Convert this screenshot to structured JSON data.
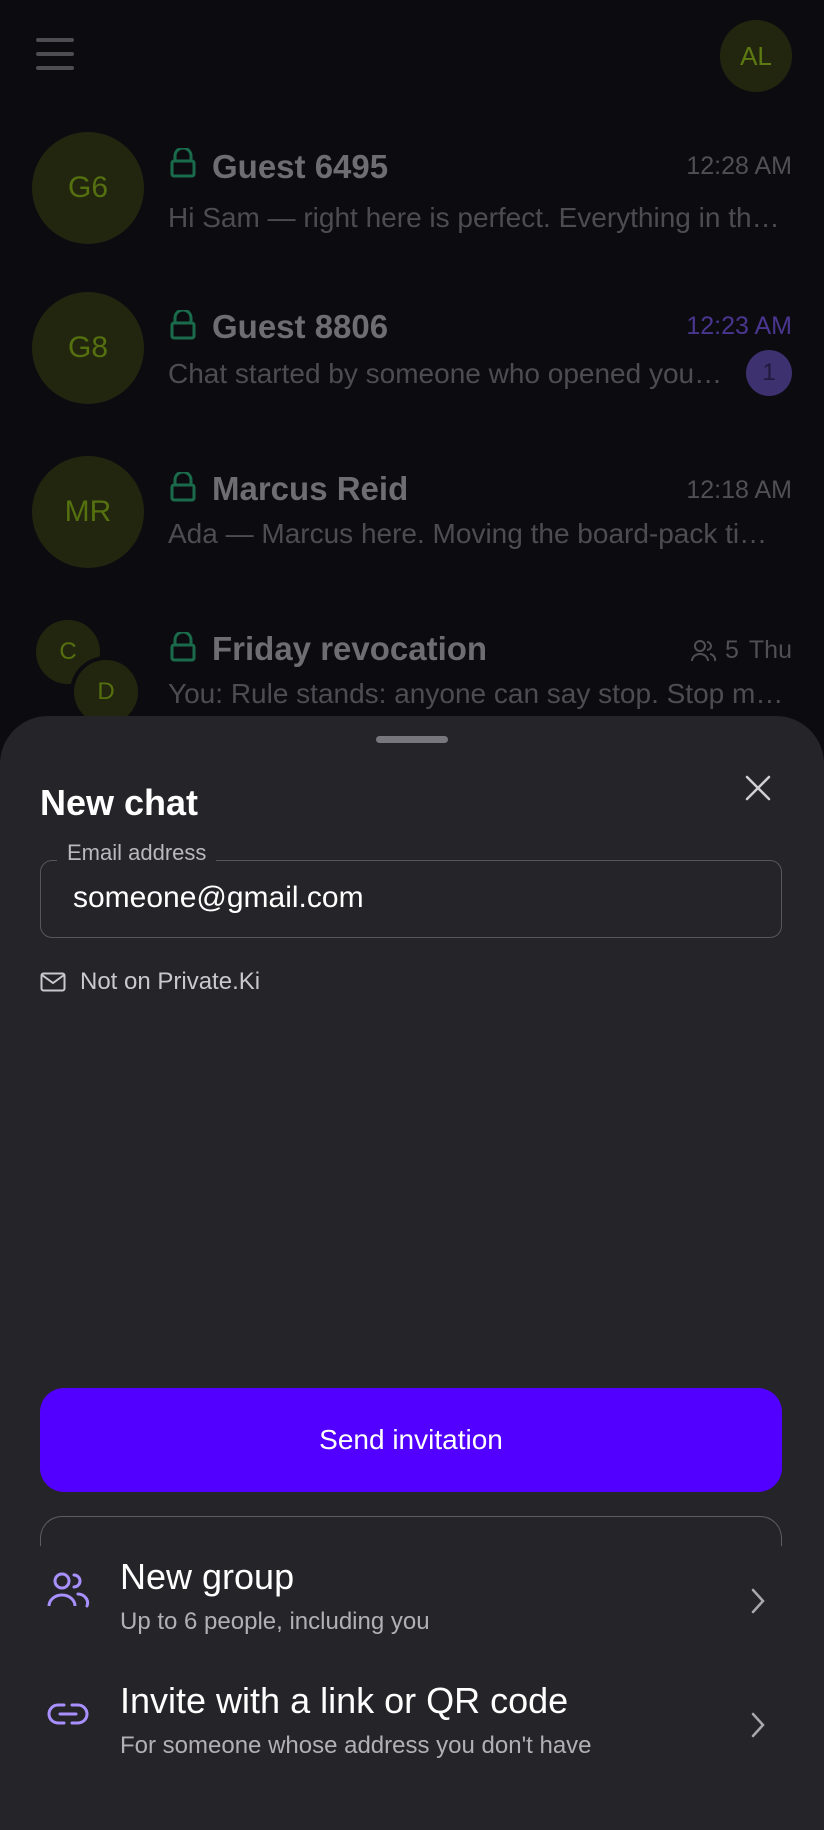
{
  "app": {
    "user_initials": "AL"
  },
  "chats": [
    {
      "initials": "G6",
      "name": "Guest 6495",
      "time": "12:28 AM",
      "preview": "Hi Sam — right here is perfect. Everything in the board pack is ready.",
      "unread": null
    },
    {
      "initials": "G8",
      "name": "Guest 8806",
      "time": "12:23 AM",
      "preview": "Chat started by someone who opened your invite link.",
      "unread": "1"
    },
    {
      "initials": "MR",
      "name": "Marcus Reid",
      "time": "12:18 AM",
      "preview": "Ada — Marcus here. Moving the board-pack timeline forward.",
      "unread": null
    },
    {
      "initials_a": "C",
      "initials_b": "D",
      "name": "Friday revocation",
      "member_count": "5",
      "time": "Thu",
      "preview_prefix": "You:",
      "preview": "Rule stands: anyone can say stop. Stop means stop."
    }
  ],
  "sheet": {
    "title": "New chat",
    "email_label": "Email address",
    "email_value": "someone@gmail.com",
    "status_text": "Not on Private.Ki",
    "send_label": "Send invitation",
    "options": [
      {
        "title": "New group",
        "subtitle": "Up to 6 people, including you",
        "icon": "users-icon"
      },
      {
        "title": "Invite with a link or QR code",
        "subtitle": "For someone whose address you don't have",
        "icon": "link-icon"
      }
    ]
  },
  "colors": {
    "accent": "#5200ff",
    "icon_accent": "#a990ff",
    "lock_green": "#1a6b4c",
    "sheet_bg": "#252529"
  }
}
